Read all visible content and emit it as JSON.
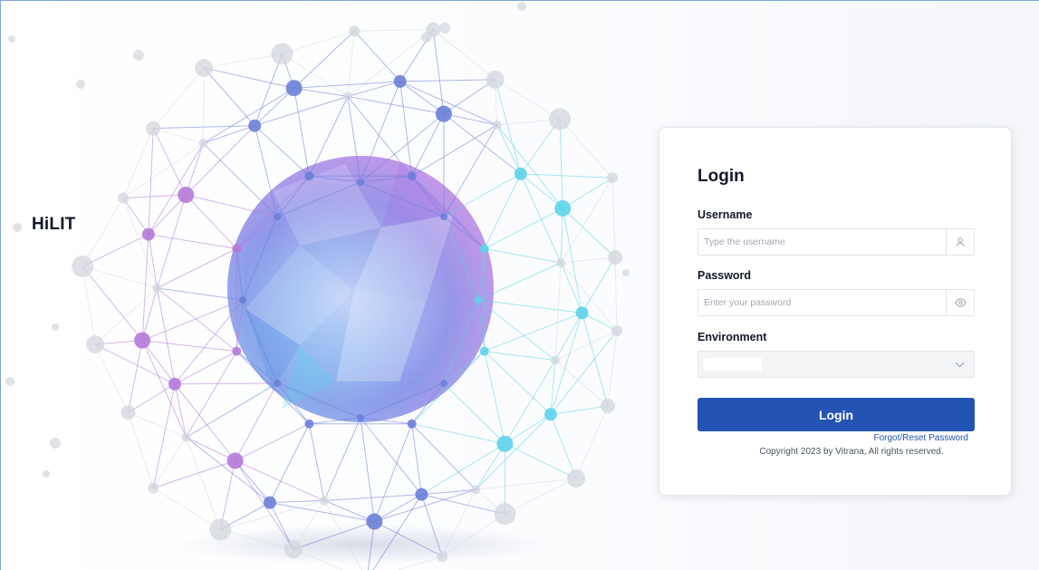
{
  "brand": {
    "name": "HiLIT"
  },
  "login": {
    "title": "Login",
    "username": {
      "label": "Username",
      "placeholder": "Type the username",
      "icon": "user-icon"
    },
    "password": {
      "label": "Password",
      "placeholder": "Enter your password",
      "icon": "eye-icon"
    },
    "environment": {
      "label": "Environment",
      "icon": "chevron-down-icon"
    },
    "submit_label": "Login",
    "forgot_label": "Forgot/Reset Password",
    "copyright": "Copyright 2023 by Vitrana, All rights reserved."
  },
  "colors": {
    "primary": "#2354b3",
    "purple_node": "#b57ad8",
    "blue_node": "#6c7fd8",
    "cyan_node": "#5fd3ea",
    "gray_node": "#d3d6de"
  }
}
